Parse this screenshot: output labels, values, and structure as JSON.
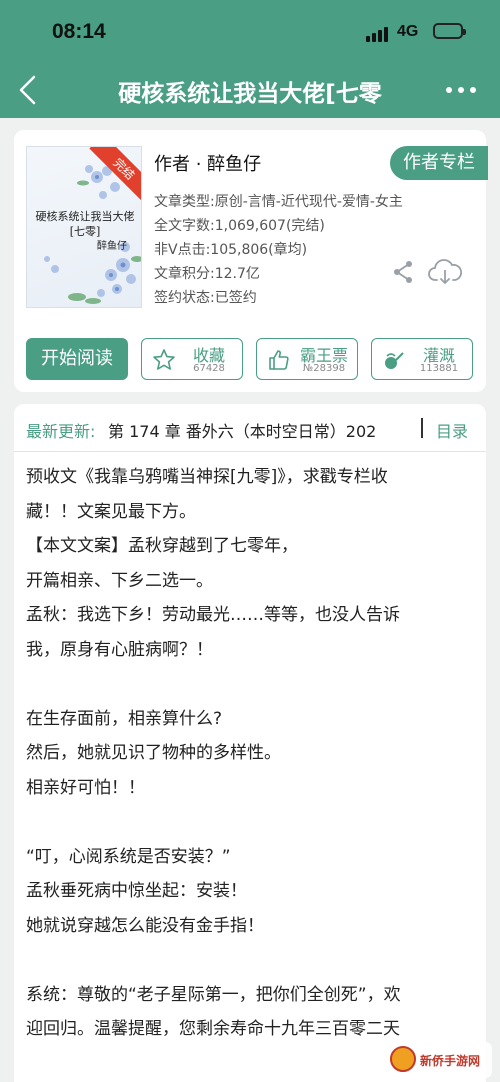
{
  "status_bar": {
    "time": "08:14",
    "network": "4G"
  },
  "nav": {
    "title": "硬核系统让我当大佬[七零"
  },
  "book": {
    "cover": {
      "ribbon": "完结",
      "title_line1": "硬核系统让我当大佬",
      "title_line2": "[七零]",
      "author": "醉鱼仔"
    },
    "author_line": "作者 · 醉鱼仔",
    "author_column_button": "作者专栏",
    "meta": [
      "文章类型:原创-言情-近代现代-爱情-女主",
      "全文字数:1,069,607(完结)",
      "非Ⅴ点击:105,806(章均)",
      "文章积分:12.7亿",
      "签约状态:已签约"
    ],
    "actions": {
      "read": "开始阅读",
      "collect": {
        "label": "收藏",
        "count": "67428"
      },
      "ticket": {
        "label": "霸王票",
        "count": "№28398"
      },
      "water": {
        "label": "灌溉",
        "count": "113881"
      }
    }
  },
  "content": {
    "update_label": "最新更新:",
    "update_text": "第 174 章 番外六（本时空日常）202",
    "toc": "目录",
    "lines": [
      "预收文《我靠乌鸦嘴当神探[九零]》，求戳专栏收",
      "藏！！文案见最下方。",
      "【本文文案】孟秋穿越到了七零年，",
      "开篇相亲、下乡二选一。",
      "孟秋：我选下乡！劳动最光……等等，也没人告诉",
      "我，原身有心脏病啊？！",
      "",
      "在生存面前，相亲算什么?",
      "然后，她就见识了物种的多样性。",
      "相亲好可怕！！",
      "",
      "“叮，心阅系统是否安装？”",
      "孟秋垂死病中惊坐起：安装！",
      "她就说穿越怎么能没有金手指！",
      "",
      "系统：尊敬的“老子星际第一，把你们全创死”，欢",
      "迎回归。温馨提醒，您剩余寿命十九年三百零二天"
    ]
  },
  "watermark": {
    "text": "新侨手游网"
  },
  "colors": {
    "accent": "#4a9e83",
    "ribbon": "#e0402c"
  }
}
